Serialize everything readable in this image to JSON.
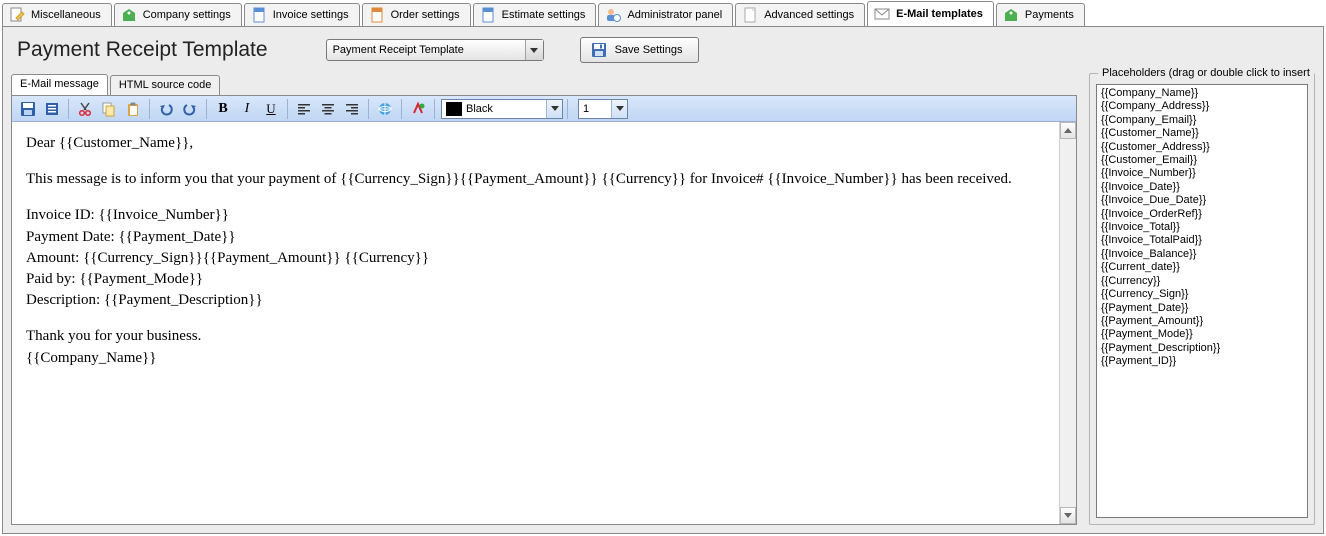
{
  "tabs": [
    {
      "label": "Miscellaneous",
      "icon": "doc-pencil",
      "active": false
    },
    {
      "label": "Company settings",
      "icon": "tag-green",
      "active": false
    },
    {
      "label": "Invoice settings",
      "icon": "doc-blue",
      "active": false
    },
    {
      "label": "Order settings",
      "icon": "doc-orange",
      "active": false
    },
    {
      "label": "Estimate settings",
      "icon": "doc-blue",
      "active": false
    },
    {
      "label": "Administrator panel",
      "icon": "admin",
      "active": false
    },
    {
      "label": "Advanced settings",
      "icon": "doc-plain",
      "active": false
    },
    {
      "label": "E-Mail templates",
      "icon": "mail",
      "active": true
    },
    {
      "label": "Payments",
      "icon": "tag-green",
      "active": false
    }
  ],
  "page": {
    "title": "Payment Receipt Template",
    "template_select": "Payment Receipt Template",
    "save_label": "Save Settings"
  },
  "subtabs": [
    {
      "label": "E-Mail message",
      "active": true
    },
    {
      "label": "HTML source code",
      "active": false
    }
  ],
  "toolbar": {
    "color_name": "Black",
    "color_hex": "#000000",
    "font_size": "1"
  },
  "email_body": [
    "Dear {{Customer_Name}},",
    "",
    "This message is to inform you that your payment of {{Currency_Sign}}{{Payment_Amount}} {{Currency}} for Invoice# {{Invoice_Number}} has been received.",
    "",
    "Invoice ID: {{Invoice_Number}}",
    "Payment Date: {{Payment_Date}}",
    "Amount: {{Currency_Sign}}{{Payment_Amount}} {{Currency}}",
    "Paid by: {{Payment_Mode}}",
    "Description: {{Payment_Description}}",
    "",
    "Thank you for your business.",
    "{{Company_Name}}"
  ],
  "placeholders": {
    "title": "Placeholders (drag or double click to insert",
    "items": [
      "{{Company_Name}}",
      "{{Company_Address}}",
      "{{Company_Email}}",
      "{{Customer_Name}}",
      "{{Customer_Address}}",
      "{{Customer_Email}}",
      "{{Invoice_Number}}",
      "{{Invoice_Date}}",
      "{{Invoice_Due_Date}}",
      "{{Invoice_OrderRef}}",
      "{{Invoice_Total}}",
      "{{Invoice_TotalPaid}}",
      "{{Invoice_Balance}}",
      "{{Current_date}}",
      "{{Currency}}",
      "{{Currency_Sign}}",
      "{{Payment_Date}}",
      "{{Payment_Amount}}",
      "{{Payment_Mode}}",
      "{{Payment_Description}}",
      "{{Payment_ID}}"
    ]
  }
}
